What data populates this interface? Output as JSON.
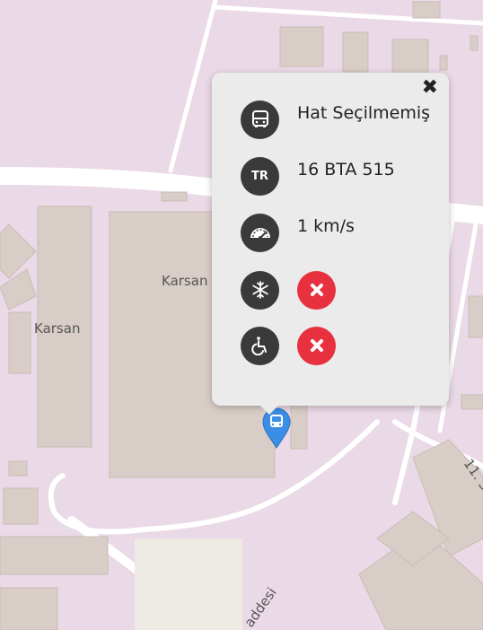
{
  "map": {
    "labels": {
      "karsan_left": "Karsan",
      "karsan_center": "Karsan",
      "street_bottom": "addesi",
      "street_right": "11. S"
    }
  },
  "popup": {
    "close_label": "✖",
    "route": "Hat Seçilmemiş",
    "plate_badge": "TR",
    "plate": "16 BTA 515",
    "speed": "1 km/s",
    "ac_status": "no",
    "accessible_status": "no"
  },
  "colors": {
    "map_bg": "#ead9e6",
    "building": "#d8cdc7",
    "road": "#ffffff",
    "pin": "#3a8ee6",
    "status_no": "#e8313e"
  },
  "icons": {
    "route": "bus-icon",
    "plate": "tr-plate-icon",
    "speed": "speedometer-icon",
    "ac": "snowflake-icon",
    "accessible": "wheelchair-icon",
    "status": "x-icon",
    "marker": "bus-marker-icon"
  }
}
